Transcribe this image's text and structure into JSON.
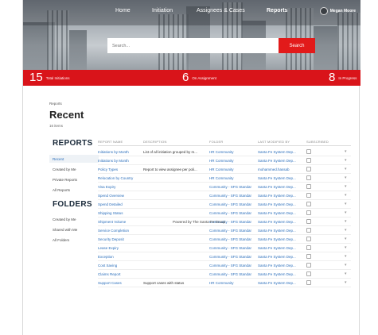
{
  "nav": {
    "items": [
      "Home",
      "Initiation",
      "Assignees & Cases",
      "Reports"
    ],
    "user_name": "Megan Moore"
  },
  "search": {
    "placeholder": "Search...",
    "button_label": "Search"
  },
  "stats": [
    {
      "value": "15",
      "label": "Total Initiations"
    },
    {
      "value": "6",
      "label": "On Assignment"
    },
    {
      "value": "8",
      "label": "In Progress"
    }
  ],
  "colors": {
    "accent": "#d9141a",
    "link": "#2a6ebb"
  },
  "page": {
    "breadcrumb": "Reports",
    "title": "Recent",
    "item_count": "16 items"
  },
  "sidebar": {
    "reports_title": "REPORTS",
    "reports_items": [
      "Recent",
      "Created by Me",
      "Private Reports",
      "All Reports"
    ],
    "folders_title": "FOLDERS",
    "folders_items": [
      "Created by Me",
      "Shared with Me",
      "All Folders"
    ]
  },
  "table": {
    "headers": [
      "REPORT NAME",
      "DESCRIPTION",
      "FOLDER",
      "LAST MODIFIED BY",
      "SUBSCRIBED"
    ],
    "rows": [
      {
        "name": "Initiations by Month",
        "description": "List of all initiation grouped by m...",
        "folder": "HR Community",
        "modified_by": "Santa Fe System Dep..."
      },
      {
        "name": "Initiations by Month",
        "description": "",
        "folder": "HR Community",
        "modified_by": "Santa Fe System Dep..."
      },
      {
        "name": "Policy Types",
        "description": "Report to view assignee per poli...",
        "folder": "HR Community",
        "modified_by": "mohammed.hassab"
      },
      {
        "name": "Relocation by Country",
        "description": "",
        "folder": "HR Community",
        "modified_by": "Santa Fe System Dep..."
      },
      {
        "name": "Visa Expiry",
        "description": "",
        "folder": "Community - SFG Standar",
        "modified_by": "Santa Fe System Dep..."
      },
      {
        "name": "Spend Overview",
        "description": "",
        "folder": "Community - SFG Standar",
        "modified_by": "Santa Fe System Dep..."
      },
      {
        "name": "Spend Detailed",
        "description": "",
        "folder": "Community - SFG Standar",
        "modified_by": "Santa Fe System Dep..."
      },
      {
        "name": "Shipping Status",
        "description": "",
        "folder": "Community - SFG Standar",
        "modified_by": "Santa Fe System Dep..."
      },
      {
        "name": "Shipment Volume",
        "description": "",
        "folder": "Community - SFG Standar",
        "modified_by": "Santa Fe System Dep..."
      },
      {
        "name": "Service Completion",
        "description": "",
        "folder": "Community - SFG Standar",
        "modified_by": "Santa Fe System Dep..."
      },
      {
        "name": "Security Deposit",
        "description": "",
        "folder": "Community - SFG Standar",
        "modified_by": "Santa Fe System Dep..."
      },
      {
        "name": "Lease Expiry",
        "description": "",
        "folder": "Community - SFG Standar",
        "modified_by": "Santa Fe System Dep..."
      },
      {
        "name": "Exception",
        "description": "",
        "folder": "Community - SFG Standar",
        "modified_by": "Santa Fe System Dep..."
      },
      {
        "name": "Cost Saving",
        "description": "",
        "folder": "Community - SFG Standar",
        "modified_by": "Santa Fe System Dep..."
      },
      {
        "name": "Claims Report",
        "description": "",
        "folder": "Community - SFG Standar",
        "modified_by": "Santa Fe System Dep..."
      },
      {
        "name": "Support Cases",
        "description": "Support cases with status",
        "folder": "HR Community",
        "modified_by": "Santa Fe System Dep..."
      }
    ]
  },
  "footer": {
    "powered_by": "Powered by The Santa Fe Group"
  }
}
